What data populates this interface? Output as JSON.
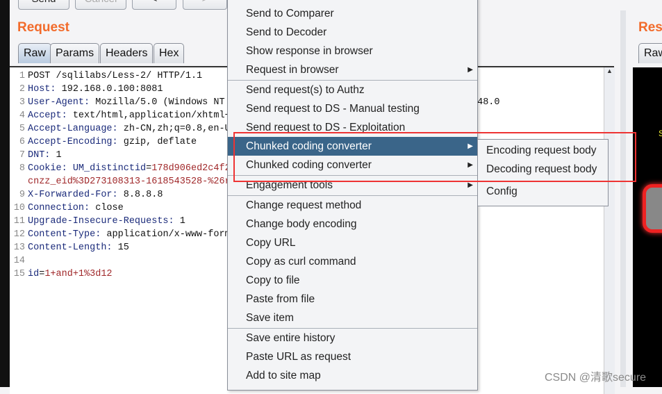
{
  "toolbar": {
    "send": "Send",
    "cancel": "Cancel",
    "back": "<",
    "forward": ">"
  },
  "request": {
    "title": "Request",
    "tabs": [
      "Raw",
      "Params",
      "Headers",
      "Hex"
    ],
    "lines": [
      {
        "n": "1",
        "parts": [
          [
            "v",
            "POST /sqlilabs/Less-2/ HTTP/1.1"
          ]
        ]
      },
      {
        "n": "2",
        "parts": [
          [
            "k",
            "Host:"
          ],
          [
            "v",
            " 192.168.0.100:8081"
          ]
        ]
      },
      {
        "n": "3",
        "parts": [
          [
            "k",
            "User-Agent:"
          ],
          [
            "v",
            " Mozilla/5.0 (Windows NT"
          ]
        ]
      },
      {
        "n": "4",
        "parts": [
          [
            "k",
            "Accept:"
          ],
          [
            "v",
            " text/html,application/xhtml+"
          ]
        ]
      },
      {
        "n": "5",
        "parts": [
          [
            "k",
            "Accept-Language:"
          ],
          [
            "v",
            " zh-CN,zh;q=0.8,en-U"
          ]
        ]
      },
      {
        "n": "6",
        "parts": [
          [
            "k",
            "Accept-Encoding:"
          ],
          [
            "v",
            " gzip, deflate"
          ]
        ]
      },
      {
        "n": "7",
        "parts": [
          [
            "k",
            "DNT:"
          ],
          [
            "v",
            " 1"
          ]
        ]
      },
      {
        "n": "8",
        "parts": [
          [
            "k",
            "Cookie:"
          ],
          [
            "v",
            " "
          ],
          [
            "k",
            "UM_distinctid"
          ],
          [
            "v",
            "="
          ],
          [
            "r",
            "178d906ed2c4f2"
          ]
        ]
      },
      {
        "n": "",
        "parts": [
          [
            "r",
            "cnzz_eid%3D273108313-1618543528-%26r"
          ]
        ]
      },
      {
        "n": "9",
        "parts": [
          [
            "k",
            "X-Forwarded-For:"
          ],
          [
            "v",
            " 8.8.8.8"
          ]
        ]
      },
      {
        "n": "10",
        "parts": [
          [
            "k",
            "Connection:"
          ],
          [
            "v",
            " close"
          ]
        ]
      },
      {
        "n": "11",
        "parts": [
          [
            "k",
            "Upgrade-Insecure-Requests:"
          ],
          [
            "v",
            " 1"
          ]
        ]
      },
      {
        "n": "12",
        "parts": [
          [
            "k",
            "Content-Type:"
          ],
          [
            "v",
            " application/x-www-form"
          ]
        ]
      },
      {
        "n": "13",
        "parts": [
          [
            "k",
            "Content-Length:"
          ],
          [
            "v",
            " 15"
          ]
        ]
      },
      {
        "n": "14",
        "parts": []
      },
      {
        "n": "15",
        "parts": [
          [
            "k",
            "id"
          ],
          [
            "v",
            "="
          ],
          [
            "r",
            "1+and+1%3d12"
          ]
        ]
      }
    ],
    "overflow_text": "/48.0"
  },
  "response": {
    "title": "Res",
    "tab": "Raw"
  },
  "context_menu": {
    "items": [
      {
        "label": "Send to Comparer"
      },
      {
        "label": "Send to Decoder"
      },
      {
        "label": "Show response in browser"
      },
      {
        "label": "Request in browser",
        "submenu": true,
        "sep_after": true
      },
      {
        "label": "Send request(s) to Authz"
      },
      {
        "label": "Send request to DS - Manual testing"
      },
      {
        "label": "Send request to DS - Exploitation"
      },
      {
        "label": "Chunked coding converter",
        "submenu": true,
        "highlighted": true
      },
      {
        "label": "Chunked coding converter",
        "submenu": true,
        "sep_after": true
      },
      {
        "label": "Engagement tools",
        "submenu": true,
        "sep_after": true
      },
      {
        "label": "Change request method"
      },
      {
        "label": "Change body encoding"
      },
      {
        "label": "Copy URL"
      },
      {
        "label": "Copy as curl command"
      },
      {
        "label": "Copy to file"
      },
      {
        "label": "Paste from file"
      },
      {
        "label": "Save item",
        "sep_after": true
      },
      {
        "label": "Save entire history"
      },
      {
        "label": "Paste URL as request"
      },
      {
        "label": "Add to site map"
      }
    ]
  },
  "submenu": {
    "items": [
      "Encoding request body",
      "Decoding request body",
      "Config"
    ]
  },
  "highlight_color": "#3a6589",
  "annotation_color": "#ee3333",
  "watermark": "CSDN @清歌secure"
}
